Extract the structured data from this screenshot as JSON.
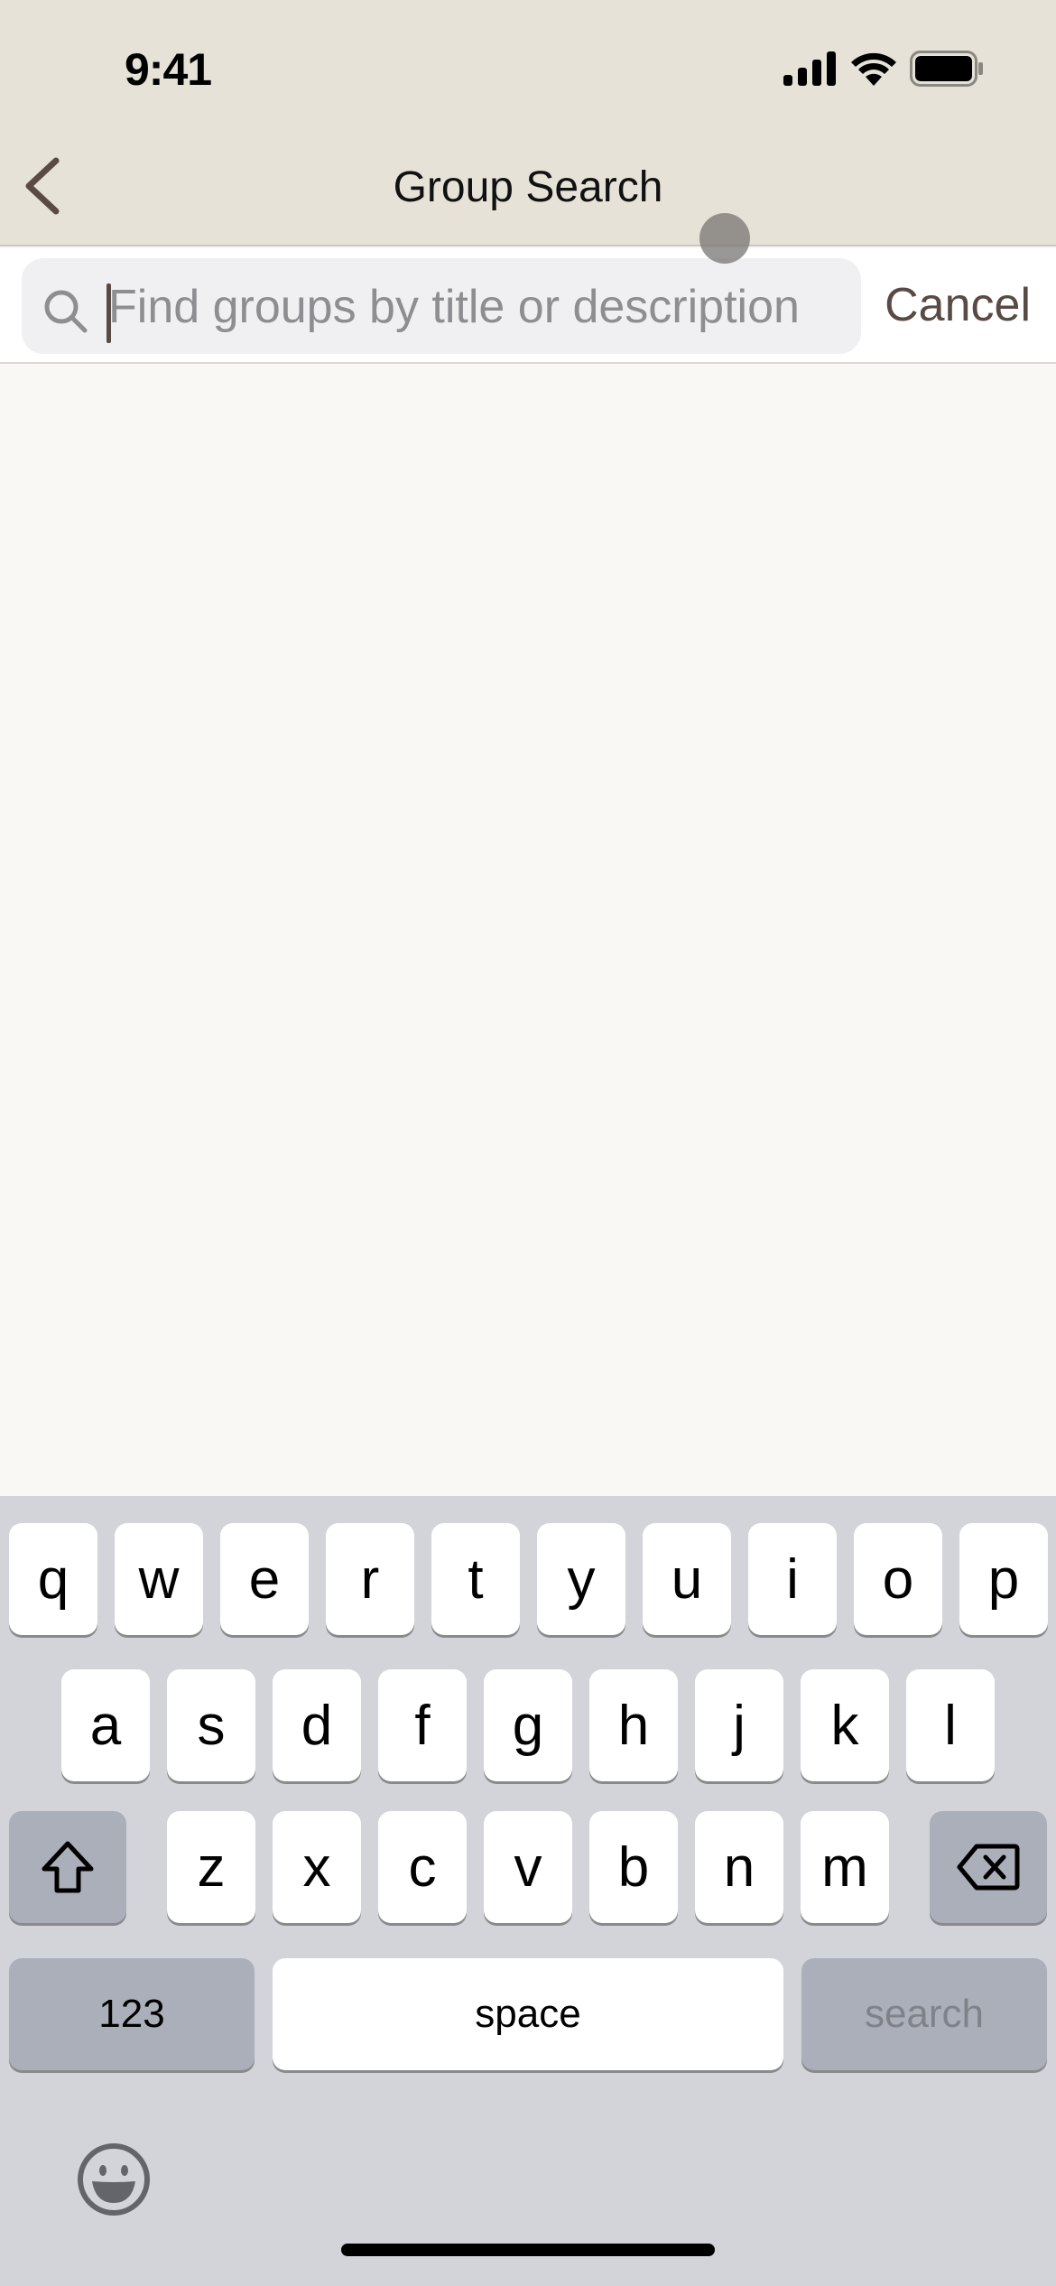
{
  "status_bar": {
    "time": "9:41",
    "icons": [
      "cellular-signal-icon",
      "wifi-icon",
      "battery-icon"
    ]
  },
  "nav": {
    "title": "Group Search",
    "back_icon": "chevron-left-icon"
  },
  "search": {
    "placeholder": "Find groups by title or description",
    "value": "",
    "cancel_label": "Cancel",
    "icon": "magnifying-glass-icon"
  },
  "colors": {
    "header_bg": "#e6e2d7",
    "accent": "#5a4a44",
    "content_bg": "#f9f8f5",
    "keyboard_bg": "#d2d4d9"
  },
  "keyboard": {
    "row1": [
      "q",
      "w",
      "e",
      "r",
      "t",
      "y",
      "u",
      "i",
      "o",
      "p"
    ],
    "row2": [
      "a",
      "s",
      "d",
      "f",
      "g",
      "h",
      "j",
      "k",
      "l"
    ],
    "row3": [
      "z",
      "x",
      "c",
      "v",
      "b",
      "n",
      "m"
    ],
    "shift_icon": "shift-arrow-icon",
    "delete_icon": "backspace-icon",
    "numbers_label": "123",
    "space_label": "space",
    "return_label": "search",
    "emoji_icon": "emoji-face-icon"
  }
}
